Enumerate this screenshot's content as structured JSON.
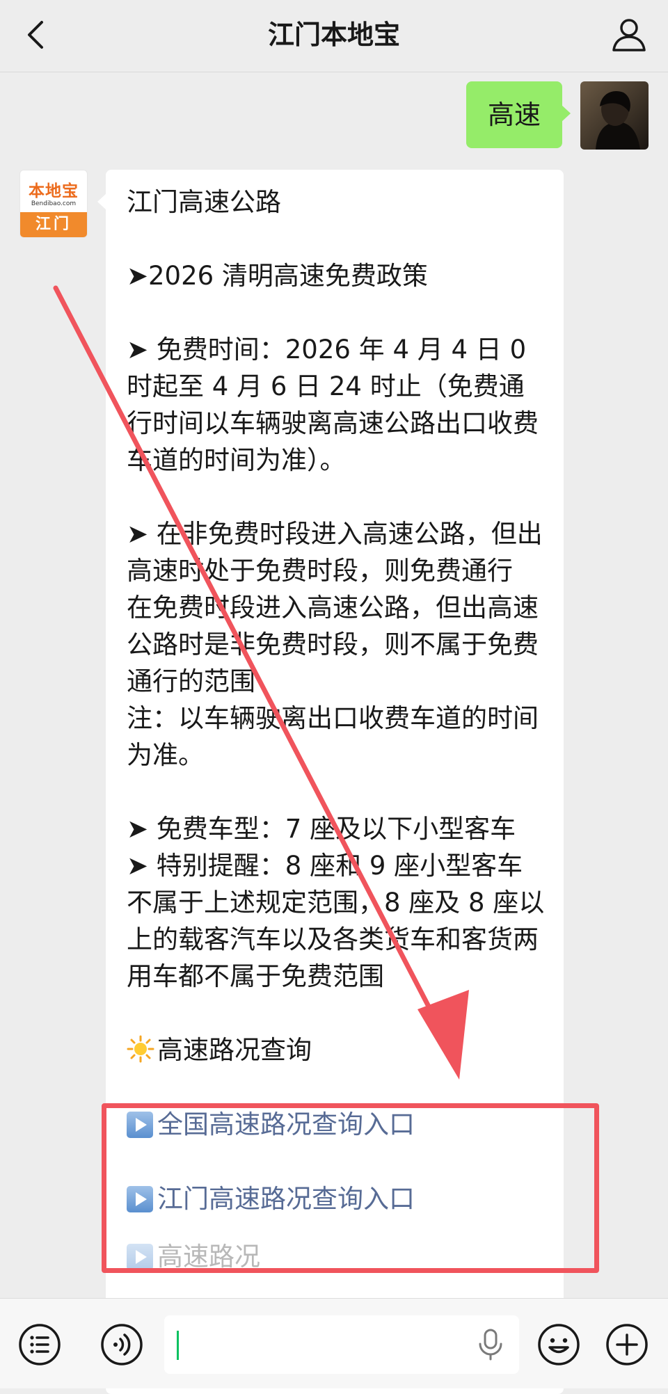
{
  "header": {
    "title": "江门本地宝",
    "back_icon": "chevron-left-icon",
    "profile_icon": "person-icon"
  },
  "sent_message": {
    "text": "高速"
  },
  "bot": {
    "avatar_top": "本地宝",
    "avatar_mid": "Bendibao.com",
    "avatar_bottom": "江门"
  },
  "received_message": {
    "line1": "江门高速公路",
    "line2": "➤2026 清明高速免费政策",
    "free_time": "➤ 免费时间：2026 年 4 月 4 日 0 时起至 4 月 6 日 24 时止（免费通行时间以车辆驶离高速公路出口收费车道的时间为准）。",
    "rule1": "➤ 在非免费时段进入高速公路，但出高速时处于免费时段，则免费通行",
    "rule2": "在免费时段进入高速公路，但出高速公路时是非免费时段，则不属于免费通行的范围",
    "note": "注：以车辆驶离出口收费车道的时间为准。",
    "vehicle_type": "➤ 免费车型：7 座及以下小型客车",
    "reminder": "➤ 特别提醒：8 座和 9 座小型客车不属于上述规定范围，8 座及 8 座以上的载客汽车以及各类货车和客货两用车都不属于免费范围",
    "road_query_heading": "高速路况查询",
    "link_national": "全国高速路况查询入口",
    "link_jiangmen": "江门高速路况查询入口",
    "partial_next": "高速路况"
  },
  "annotation": {
    "arrow_color": "#f0545c",
    "box_color": "#f0545c"
  },
  "input_bar": {
    "menu_icon": "list-icon",
    "voice_icon": "voice-icon",
    "mic_icon": "microphone-icon",
    "emoji_icon": "emoji-icon",
    "add_icon": "plus-icon",
    "input_value": ""
  },
  "colors": {
    "background": "#ededed",
    "sent_bubble": "#95ec69",
    "link": "#576b95"
  }
}
